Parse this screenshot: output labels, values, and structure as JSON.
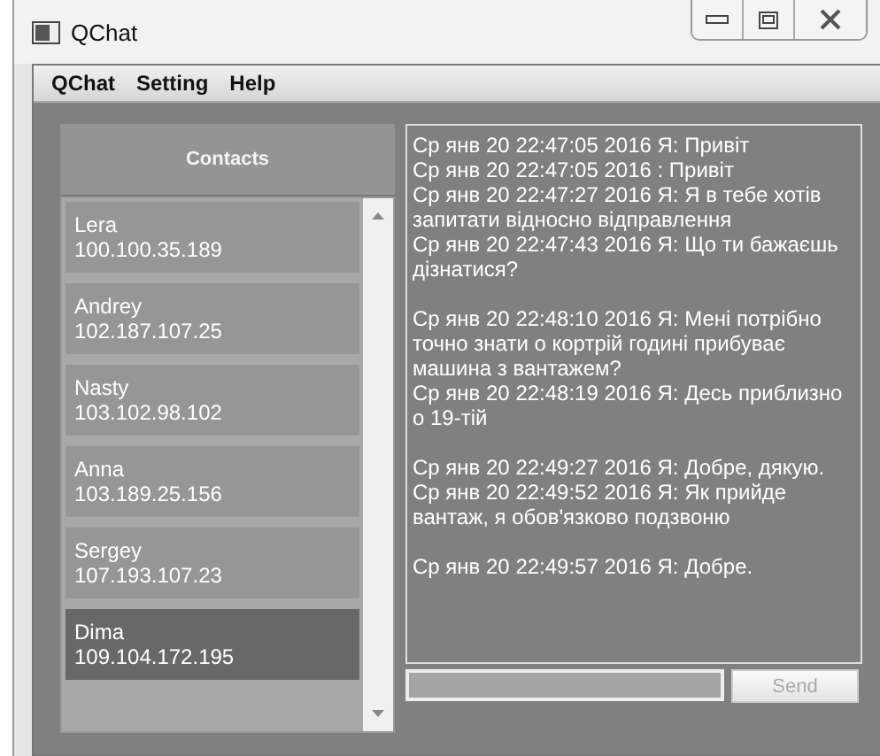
{
  "window": {
    "title": "QChat"
  },
  "menu": [
    "QChat",
    "Setting",
    "Help"
  ],
  "contacts": {
    "title": "Contacts",
    "items": [
      {
        "name": "Lera",
        "address": "100.100.35.189",
        "selected": false
      },
      {
        "name": "Andrey",
        "address": "102.187.107.25",
        "selected": false
      },
      {
        "name": "Nasty",
        "address": "103.102.98.102",
        "selected": false
      },
      {
        "name": "Anna",
        "address": "103.189.25.156",
        "selected": false
      },
      {
        "name": "Sergey",
        "address": "107.193.107.23",
        "selected": false
      },
      {
        "name": "Dima",
        "address": "109.104.172.195",
        "selected": true
      }
    ]
  },
  "chat": {
    "paragraphs": [
      {
        "messages": [
          "Ср янв 20 22:47:05 2016 Я: Привіт",
          "Ср янв 20 22:47:05 2016 : Привіт",
          "Ср янв 20 22:47:27 2016 Я: Я в тебе хотів запитати відносно відправлення",
          "Ср янв 20 22:47:43 2016 Я: Що ти бажаєшь дізнатися?"
        ]
      },
      {
        "messages": [
          "Ср янв 20 22:48:10 2016 Я: Мені потрібно точно знати о кортрій годині прибуває машина з вантажем?",
          "Ср янв 20 22:48:19 2016 Я: Десь приблизно о 19-тій"
        ]
      },
      {
        "messages": [
          "Ср янв 20 22:49:27 2016 Я: Добре, дякую.",
          "Ср янв 20 22:49:52 2016 Я: Як прийде вантаж, я обов'язково подзвоню"
        ]
      },
      {
        "messages": [
          "Ср янв 20 22:49:57 2016 Я: Добре."
        ]
      }
    ]
  },
  "send_button": {
    "label": "Send",
    "disabled": true
  }
}
